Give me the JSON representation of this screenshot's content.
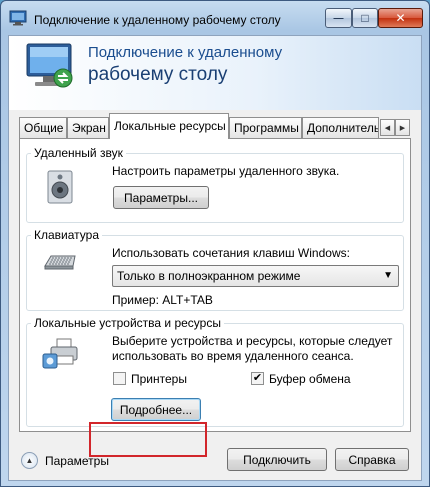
{
  "window": {
    "title": "Подключение к удаленному рабочему столу",
    "minimize_glyph": "—",
    "maximize_glyph": "□",
    "close_glyph": "✕"
  },
  "banner": {
    "line1": "Подключение к удаленному",
    "line2": "рабочему столу"
  },
  "tabs": [
    {
      "label": "Общие",
      "active": false
    },
    {
      "label": "Экран",
      "active": false
    },
    {
      "label": "Локальные ресурсы",
      "active": true
    },
    {
      "label": "Программы",
      "active": false
    },
    {
      "label": "Дополнительно",
      "active": false
    }
  ],
  "tab_scroll": {
    "left": "◀",
    "right": "▶"
  },
  "remote_audio": {
    "title": "Удаленный звук",
    "description": "Настроить параметры удаленного звука.",
    "settings_button": "Параметры..."
  },
  "keyboard": {
    "title": "Клавиатура",
    "description": "Использовать сочетания клавиш Windows:",
    "selected_option": "Только в полноэкранном режиме",
    "example": "Пример: ALT+TAB"
  },
  "local_devices": {
    "title": "Локальные устройства и ресурсы",
    "description_line1": "Выберите устройства и ресурсы, которые следует",
    "description_line2": "использовать во время удаленного сеанса.",
    "printers_label": "Принтеры",
    "printers_checked": false,
    "clipboard_label": "Буфер обмена",
    "clipboard_checked": true,
    "check_glyph": "✔",
    "more_button": "Подробнее..."
  },
  "footer": {
    "options_toggle_glyph": "▲",
    "options_label": "Параметры",
    "connect_button": "Подключить",
    "help_button": "Справка"
  },
  "colors": {
    "highlight_border": "#d2262b",
    "banner_text": "#1a4d8f",
    "close_button": "#c2300f"
  }
}
